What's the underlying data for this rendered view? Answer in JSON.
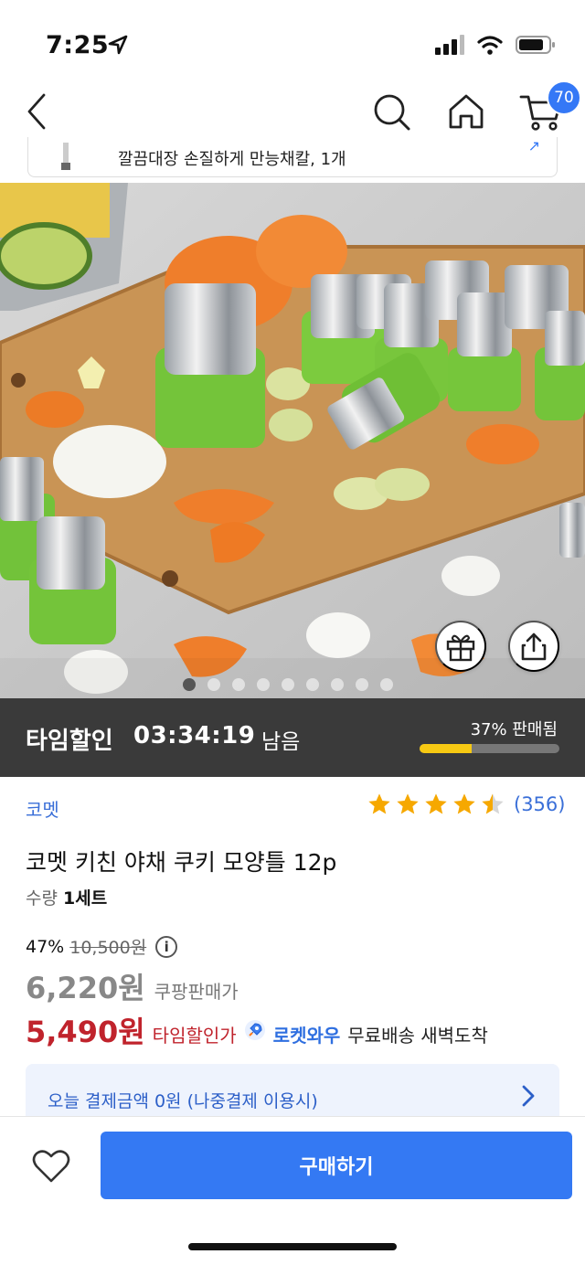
{
  "status_bar": {
    "time": "7:25"
  },
  "nav": {
    "cart_badge": "70"
  },
  "related": {
    "text": "깔끔대장 손질하게 만능채칼, 1개"
  },
  "image_carousel": {
    "dot_count": 9,
    "active_index": 0
  },
  "time_deal": {
    "label": "타임할인",
    "time": "03:34:19",
    "remaining": "남음",
    "sold_text": "37% 판매됨",
    "sold_fraction": 0.37
  },
  "product": {
    "brand": "코멧",
    "rating": 4.5,
    "review_count": "(356)",
    "title": "코멧 키친 야채 쿠키 모양틀 12p",
    "qty_label": "수량",
    "qty_value": "1세트"
  },
  "pricing": {
    "discount": "47%",
    "original_price": "10,500원",
    "coupang_price": "6,220원",
    "coupang_label": "쿠팡판매가",
    "deal_price": "5,490원",
    "deal_label": "타임할인가",
    "rocket_label": "로켓와우",
    "shipping_label": "무료배송 새벽도착"
  },
  "later_pay": {
    "text": "오늘 결제금액 0원 (나중결제 이용시)"
  },
  "actions": {
    "buy_label": "구매하기"
  },
  "colors": {
    "accent": "#3479f3",
    "deal_red": "#c0232c",
    "timedeal_bg": "#3a3a3a",
    "progress_yellow": "#f7c913",
    "star": "#f6a800"
  }
}
